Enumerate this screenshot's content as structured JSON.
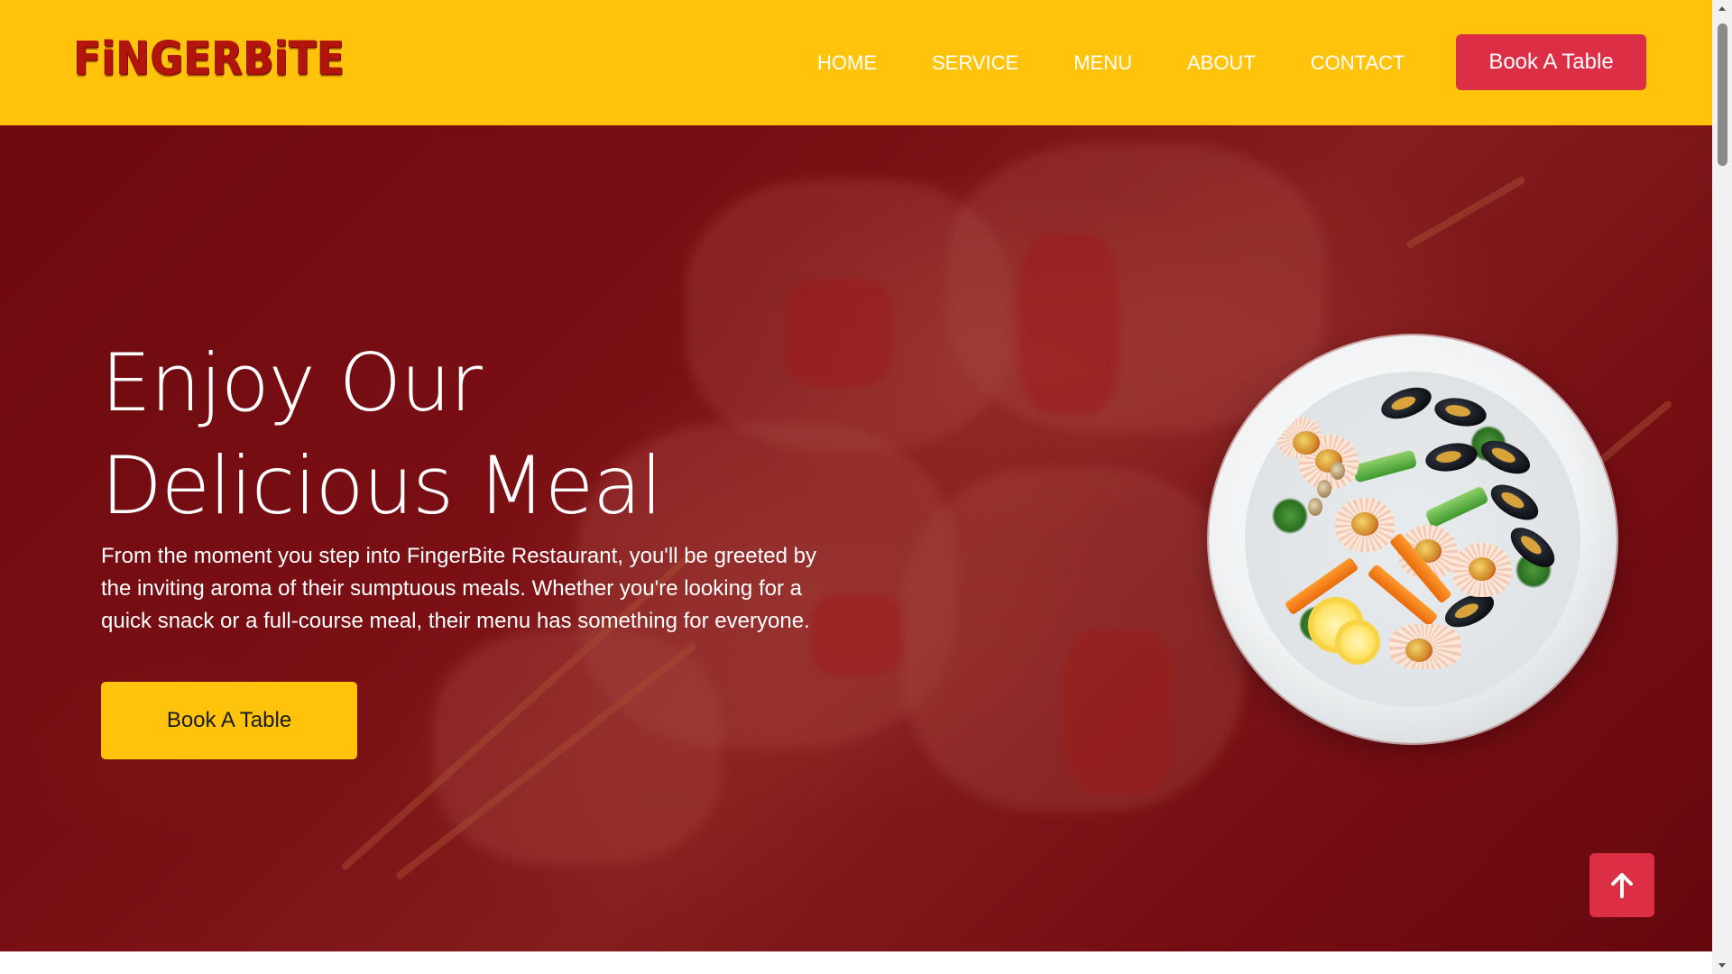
{
  "header": {
    "logo_text": "FiNGERBiTE",
    "nav": [
      {
        "label": "HOME"
      },
      {
        "label": "SERVICE"
      },
      {
        "label": "MENU"
      },
      {
        "label": "ABOUT"
      },
      {
        "label": "CONTACT"
      }
    ],
    "cta_label": "Book A Table"
  },
  "hero": {
    "title_line1": "Enjoy Our",
    "title_line2": "Delicious Meal",
    "description": "From the moment you step into FingerBite Restaurant, you'll be greeted by the inviting aroma of their sumptuous meals. Whether you're looking for a quick snack or a full-course meal, their menu has something for everyone.",
    "cta_label": "Book A Table",
    "image_subject": "seafood-platter-plate"
  },
  "scroll_top": {
    "icon": "arrow-up-icon"
  },
  "colors": {
    "primary_yellow": "#ffc30b",
    "accent_red": "#dc2f45",
    "hero_overlay": "#6e080e",
    "logo_red": "#b3140c"
  }
}
